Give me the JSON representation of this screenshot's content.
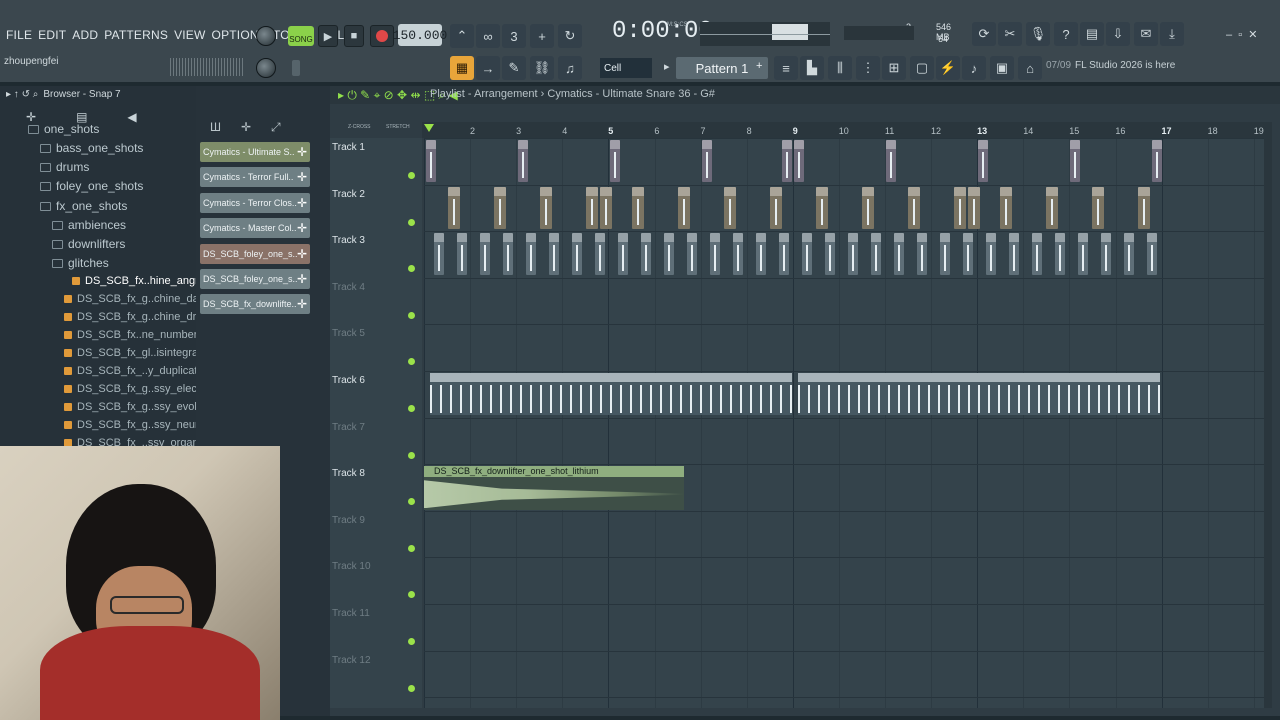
{
  "menu": [
    "FILE",
    "EDIT",
    "ADD",
    "PATTERNS",
    "VIEW",
    "OPTIONS",
    "TOOLS",
    "HELP"
  ],
  "transport": {
    "song_mode": "SONG",
    "tempo": "150.000",
    "time": "0:00:00",
    "time_sub": "M:S:CS"
  },
  "cpu": {
    "ram": "546 MB",
    "poly": "64",
    "voices": "2"
  },
  "hint_user": "zhoupengfei",
  "snap": "Cell",
  "pattern": "Pattern 1",
  "news": {
    "date": "07/09",
    "text": "FL Studio 2026 is here"
  },
  "browser": {
    "title": "Browser - Snap 7",
    "tree": [
      {
        "label": "one_shots",
        "level": 1,
        "type": "folder"
      },
      {
        "label": "bass_one_shots",
        "level": 2,
        "type": "folder"
      },
      {
        "label": "drums",
        "level": 2,
        "type": "folder"
      },
      {
        "label": "foley_one_shots",
        "level": 2,
        "type": "folder"
      },
      {
        "label": "fx_one_shots",
        "level": 2,
        "type": "folder"
      },
      {
        "label": "ambiences",
        "level": 3,
        "type": "folder"
      },
      {
        "label": "downlifters",
        "level": 3,
        "type": "folder"
      },
      {
        "label": "glitches",
        "level": 3,
        "type": "folder"
      }
    ],
    "files": [
      "DS_SCB_fx..hine_angry",
      "DS_SCB_fx_g..chine_data",
      "DS_SCB_fx_g..chine_drill",
      "DS_SCB_fx..ne_numbers",
      "DS_SCB_fx_gl..isintegrate",
      "DS_SCB_fx_..y_duplicate",
      "DS_SCB_fx_g..ssy_electrify",
      "DS_SCB_fx_g..ssy_evolve",
      "DS_SCB_fx_g..ssy_neural",
      "DS_SCB_fx_..ssy_organic"
    ]
  },
  "channels": [
    {
      "label": "Cymatics - Ultimate S..",
      "color": "#7e8d69"
    },
    {
      "label": "Cymatics - Terror Full..",
      "color": "#6e7f84"
    },
    {
      "label": "Cymatics - Terror Clos..",
      "color": "#6e7f84"
    },
    {
      "label": "Cymatics - Master Col..",
      "color": "#6e7f84"
    },
    {
      "label": "DS_SCB_foley_one_s..",
      "color": "#8a7268"
    },
    {
      "label": "DS_SCB_foley_one_s..",
      "color": "#6e7f84"
    },
    {
      "label": "DS_SCB_fx_downlifte..",
      "color": "#6e7f84"
    }
  ],
  "playlist": {
    "title": "Playlist - Arrangement",
    "pattern_path": "Cymatics - Ultimate Snare 36 - G#",
    "ruler": [
      "2",
      "3",
      "4",
      "5",
      "6",
      "7",
      "8",
      "9",
      "10",
      "11",
      "12",
      "13",
      "14",
      "15",
      "16",
      "17",
      "18",
      "19"
    ],
    "tracks": [
      "Track 1",
      "Track 2",
      "Track 3",
      "Track 4",
      "Track 5",
      "Track 6",
      "Track 7",
      "Track 8",
      "Track 9",
      "Track 10",
      "Track 11",
      "Track 12"
    ],
    "audio_clip": "DS_SCB_fx_downlifter_one_shot_lithium",
    "zcross": "Z-CROSS",
    "stretch": "STRETCH"
  }
}
